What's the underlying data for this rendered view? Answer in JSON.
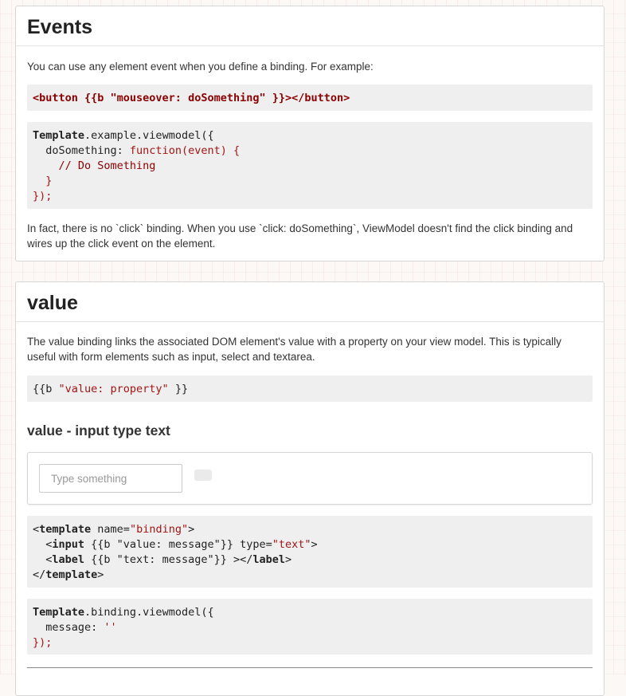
{
  "events": {
    "title": "Events",
    "intro": "You can use any element event when you define a binding. For example:",
    "snippet1": "<button {{b \"mouseover: doSomething\" }}></button>",
    "snippet2": {
      "line1_kw": "Template",
      "line1_rest": ".example.viewmodel({",
      "line2_name": "  doSomething: ",
      "line2_fn": "function(event) {",
      "line3": "    // Do Something",
      "line4": "  }",
      "line5": "});"
    },
    "note": "In fact, there is no `click` binding. When you use `click: doSomething`, ViewModel doesn't find the click binding and wires up the click event on the element."
  },
  "value": {
    "title": "value",
    "intro": "The value binding links the associated DOM element's value with a property on your view model. This is typically useful with form elements such as input, select and textarea.",
    "snippet_pre": "{{b ",
    "snippet_str": "\"value: property\"",
    "snippet_post": " }}",
    "subtitle": "value - input type text",
    "demo_placeholder": "Type something",
    "template_code": {
      "t_open": "template",
      "t_attr": " name=",
      "t_attr_val": "\"binding\"",
      "input_tag": "input",
      "input_mid": " {{b \"value: message\"}} type=",
      "input_val": "\"text\"",
      "label_tag": "label",
      "label_mid": " {{b \"text: message\"}} ></",
      "label_close": "label",
      "t_close": "template"
    },
    "vm_code": {
      "kw": "Template",
      "rest": ".binding.viewmodel({",
      "line2": "  message: ",
      "line2_str": "''",
      "line3": "});"
    }
  }
}
